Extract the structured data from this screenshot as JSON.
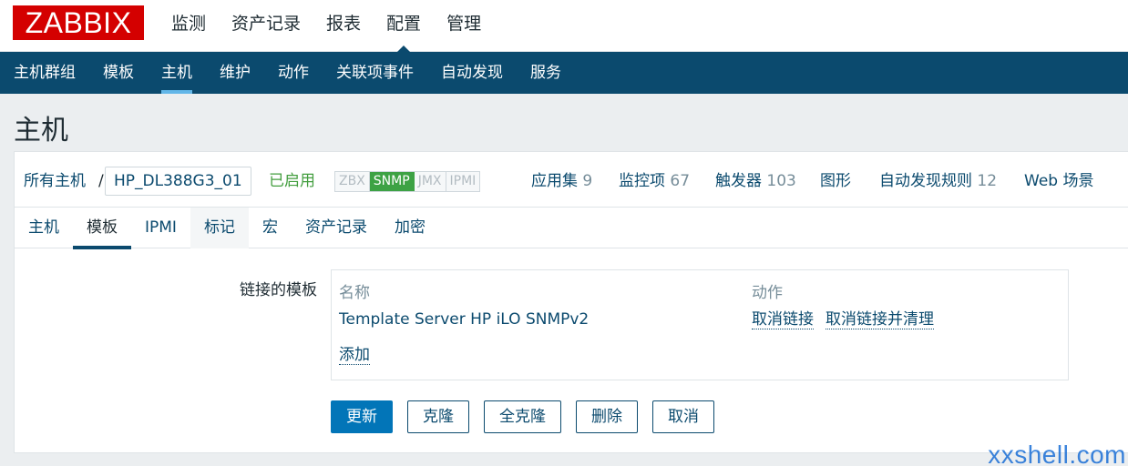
{
  "logo": "ZABBIX",
  "main_nav": [
    "监测",
    "资产记录",
    "报表",
    "配置",
    "管理"
  ],
  "main_nav_active": 3,
  "sub_nav": [
    "主机群组",
    "模板",
    "主机",
    "维护",
    "动作",
    "关联项事件",
    "自动发现",
    "服务"
  ],
  "sub_nav_active": 2,
  "page_title": "主机",
  "host_bar": {
    "all_hosts": "所有主机",
    "separator": "/",
    "current_host": "HP_DL388G3_01",
    "enabled": "已启用",
    "status": [
      {
        "label": "ZBX",
        "on": false
      },
      {
        "label": "SNMP",
        "on": true
      },
      {
        "label": "JMX",
        "on": false
      },
      {
        "label": "IPMI",
        "on": false
      }
    ],
    "links": [
      {
        "label": "应用集",
        "count": "9"
      },
      {
        "label": "监控项",
        "count": "67"
      },
      {
        "label": "触发器",
        "count": "103"
      },
      {
        "label": "图形",
        "count": ""
      },
      {
        "label": "自动发现规则",
        "count": "12"
      },
      {
        "label": "Web 场景",
        "count": ""
      }
    ]
  },
  "tabs": [
    "主机",
    "模板",
    "IPMI",
    "标记",
    "宏",
    "资产记录",
    "加密"
  ],
  "tabs_active": 1,
  "form": {
    "linked_label": "链接的模板",
    "col_name": "名称",
    "col_action": "动作",
    "template_name": "Template Server HP iLO SNMPv2",
    "unlink": "取消链接",
    "unlink_clear": "取消链接并清理",
    "add": "添加"
  },
  "buttons": {
    "update": "更新",
    "clone": "克隆",
    "full_clone": "全克隆",
    "delete": "删除",
    "cancel": "取消"
  },
  "watermark": "xxshell.com",
  "colors": {
    "brand_red": "#d40000",
    "nav_blue": "#0b4a6e",
    "link_blue": "#0b4a6e",
    "enabled_green": "#439e3f",
    "primary_button": "#0275b8"
  }
}
